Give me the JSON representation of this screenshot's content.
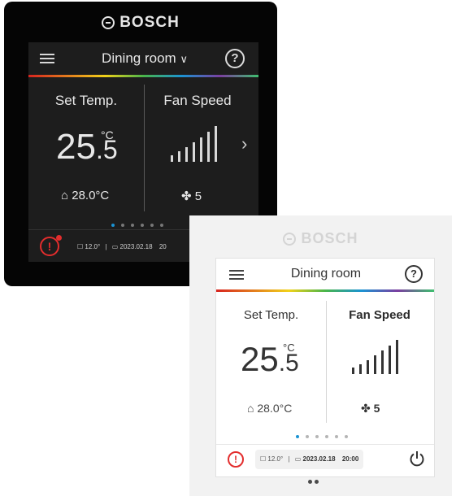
{
  "black_device": {
    "brand": "BOSCH",
    "room": "Dining room",
    "room_caret": "∨",
    "help": "?",
    "set_temp_label": "Set Temp.",
    "set_temp_int": "25",
    "set_temp_unit": "°C",
    "set_temp_dec": ".5",
    "indoor_temp": "28.0°C",
    "fan_label": "Fan Speed",
    "fan_level": "5",
    "next": "›",
    "outdoor": "12.0°",
    "separator": "|",
    "date": "2023.02.18",
    "time": "20"
  },
  "white_device": {
    "brand": "BOSCH",
    "room": "Dining room",
    "help": "?",
    "set_temp_label": "Set Temp.",
    "set_temp_int": "25",
    "set_temp_unit": "°C",
    "set_temp_dec": ".5",
    "indoor_temp": "28.0°C",
    "fan_label": "Fan Speed",
    "fan_level": "5",
    "alert": "!",
    "outdoor": "12.0°",
    "separator": "|",
    "date": "2023.02.18",
    "time": "20:00"
  },
  "icons": [
    "menu-icon",
    "help-icon",
    "house-thermometer-icon",
    "fan-icon",
    "chevron-right-icon",
    "alert-icon",
    "outdoor-temp-icon",
    "calendar-icon",
    "power-icon"
  ],
  "colors": {
    "alert": "#e32d2d",
    "active_dot": "#1b93d3",
    "rainbow": [
      "#d8241f",
      "#e37b1e",
      "#f1d21a",
      "#49b54a",
      "#1b93d3",
      "#7b3fa0"
    ]
  },
  "fan_bars": 7,
  "page_dots": {
    "count": 6,
    "active_index": 0
  },
  "device_pager": {
    "count": 2
  }
}
